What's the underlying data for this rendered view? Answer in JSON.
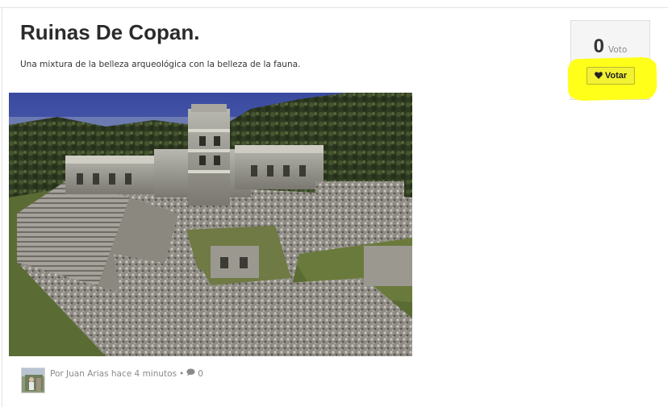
{
  "post": {
    "title": "Ruinas De Copan.",
    "description": "Una mixtura de la belleza arqueológica con la belleza de la fauna.",
    "image_alt": "Ruinas De Copan"
  },
  "vote": {
    "count": "0",
    "unit": "Voto",
    "button_label": "Votar",
    "button_icon": "heart-icon",
    "highlight_color": "#ffff1a"
  },
  "meta": {
    "by_prefix": "Por",
    "author": "Juan Arias",
    "time": "hace 4 minutos",
    "separator": "•",
    "comments_icon": "comment-icon",
    "comments_count": "0"
  }
}
